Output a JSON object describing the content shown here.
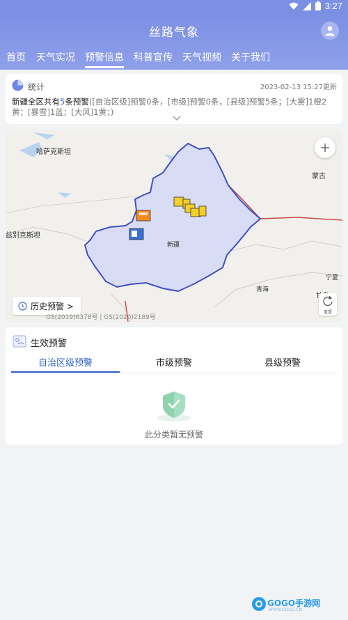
{
  "status_bar": {
    "time": "3:27"
  },
  "header": {
    "title": "丝路气象",
    "tabs": [
      {
        "label": "首页"
      },
      {
        "label": "天气实况"
      },
      {
        "label": "预警信息"
      },
      {
        "label": "科普宣传"
      },
      {
        "label": "天气视频"
      },
      {
        "label": "关于我们"
      }
    ],
    "active_tab": "预警信息"
  },
  "stats": {
    "label": "统计",
    "updated": "2023-02-13 15:27更新",
    "summary_prefix": "新疆全区共有",
    "summary_count": "5",
    "summary_suffix": "条预警",
    "summary_detail": "([自治区级]预警0条，[市级]预警0条，[县级]预警5条；[大雾]1橙2黄；[暴雪]1蓝；[大风]1黄；)"
  },
  "map": {
    "labels": {
      "kazakhstan": "哈萨克斯坦",
      "mongolia": "蒙古",
      "uzbekistan": "兹别克斯坦",
      "xinjiang": "新疆",
      "qinghai": "青海",
      "ningxia": "宁夏",
      "gansu": "甘肃"
    },
    "history_button": "历史预警 >",
    "copyright": "GS(2019)6378号 | GS(2020)2189号",
    "reset_label": "重置"
  },
  "warnings": {
    "title": "生效预警",
    "tabs": [
      {
        "label": "自治区级预警"
      },
      {
        "label": "市级预警"
      },
      {
        "label": "县级预警"
      }
    ],
    "empty_text": "此分类暂无预警"
  },
  "watermark": {
    "text": "GOGO手游网",
    "url": "WWW.GOGO.CN"
  },
  "colors": {
    "header": "#7b8fe3",
    "accent": "#2f63cc",
    "region_fill": "#d9dcf5",
    "region_border": "#3f51c0",
    "warning_yellow": "#f2cf2a",
    "warning_orange": "#f08a24",
    "warning_blue": "#3a6fd8"
  }
}
